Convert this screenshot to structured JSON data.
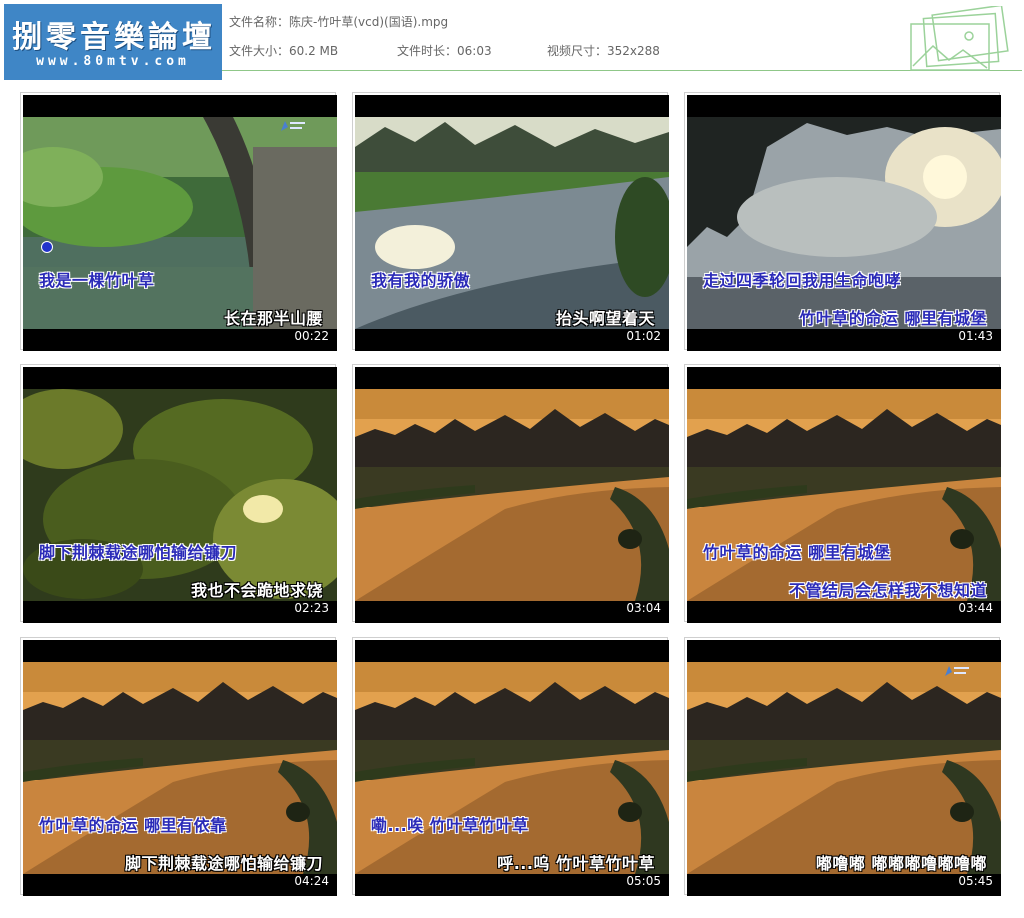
{
  "logo": {
    "title": "捌零音樂論壇",
    "url": "www.80mtv.com"
  },
  "file_info": {
    "name_label": "文件名称：",
    "name_value": "陈庆-竹叶草(vcd)(国语).mpg",
    "size_label": "文件大小：",
    "size_value": "60.2 MB",
    "duration_label": "文件时长：",
    "duration_value": "06:03",
    "dims_label": "视频尺寸：",
    "dims_value": "352x288"
  },
  "thumbnails": [
    {
      "time": "00:22",
      "lyric1": "我是一棵竹叶草",
      "lyric2": "长在那半山腰",
      "scene": "bridge",
      "lyric2_style": "white"
    },
    {
      "time": "01:02",
      "lyric1": "我有我的骄傲",
      "lyric2": "抬头啊望着天",
      "scene": "river-day",
      "lyric2_style": "white"
    },
    {
      "time": "01:43",
      "lyric1": "走过四季轮回我用生命咆哮",
      "lyric2": "竹叶草的命运 哪里有城堡",
      "scene": "reflection",
      "lyric2_style": "blue"
    },
    {
      "time": "02:23",
      "lyric1": "脚下荆棘载途哪怕输给镰刀",
      "lyric2": "我也不会跪地求饶",
      "scene": "leaves",
      "lyric2_style": "white"
    },
    {
      "time": "03:04",
      "lyric1": "",
      "lyric2": "",
      "scene": "sunset",
      "lyric2_style": "white"
    },
    {
      "time": "03:44",
      "lyric1": "竹叶草的命运 哪里有城堡",
      "lyric2": "不管结局会怎样我不想知道",
      "scene": "sunset",
      "lyric2_style": "blue"
    },
    {
      "time": "04:24",
      "lyric1": "竹叶草的命运 哪里有依靠",
      "lyric2": "脚下荆棘载途哪怕输给镰刀",
      "scene": "sunset",
      "lyric2_style": "white"
    },
    {
      "time": "05:05",
      "lyric1": "嘞...唉 竹叶草竹叶草",
      "lyric2": "呼...呜 竹叶草竹叶草",
      "scene": "sunset",
      "lyric2_style": "white"
    },
    {
      "time": "05:45",
      "lyric1": "",
      "lyric2": "嘟噜嘟 嘟嘟嘟噜嘟噜嘟",
      "scene": "sunset",
      "lyric2_style": "white"
    }
  ],
  "colors": {
    "logo_bg": "#3f86c6",
    "header_line": "#8fc788",
    "lyric_blue": "#2b2bb8"
  }
}
